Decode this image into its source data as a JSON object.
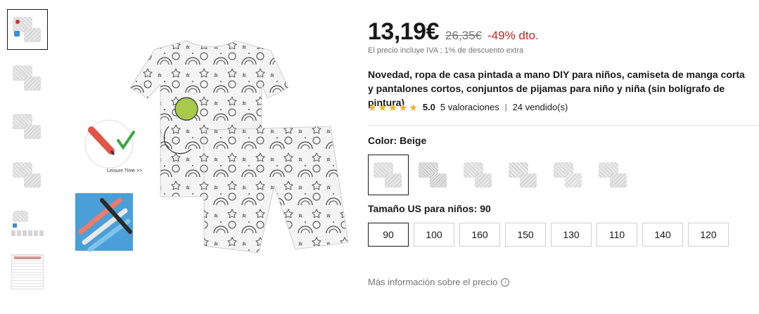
{
  "gallery": {
    "thumbnails": [
      "pajama-set",
      "pajama-set",
      "pajama-set",
      "pajama-set",
      "pajama-set-grid",
      "size-chart"
    ],
    "active_index": 0
  },
  "main_image": {
    "caption": "Leisure Time >>"
  },
  "pricing": {
    "price": "13,19€",
    "old_price": "26,35€",
    "discount": "-49% dto.",
    "vat_note": "El precio incluye IVA ; 1% de descuento extra",
    "discount_color": "#c62828"
  },
  "product": {
    "title": "Novedad, ropa de casa pintada a mano DIY para niños, camiseta de manga corta y pantalones cortos, conjuntos de pijamas para niño y niña (sin bolígrafo de pintura)"
  },
  "rating": {
    "stars": 5,
    "score": "5.0",
    "reviews": "5 valoraciones",
    "separator": "|",
    "sold": "24 vendido(s)",
    "star_color": "#f5b400"
  },
  "color": {
    "label": "Color: Beige",
    "options": [
      "Beige",
      "Variant 2",
      "Variant 3",
      "Variant 4",
      "Variant 5",
      "Variant 6"
    ],
    "selected_index": 0
  },
  "size": {
    "label": "Tamaño US para niños: 90",
    "options": [
      "90",
      "100",
      "160",
      "150",
      "130",
      "110",
      "140",
      "120"
    ],
    "selected_index": 0
  },
  "footer": {
    "more_info": "Más información sobre el precio",
    "info_icon": "info-circle-icon"
  }
}
